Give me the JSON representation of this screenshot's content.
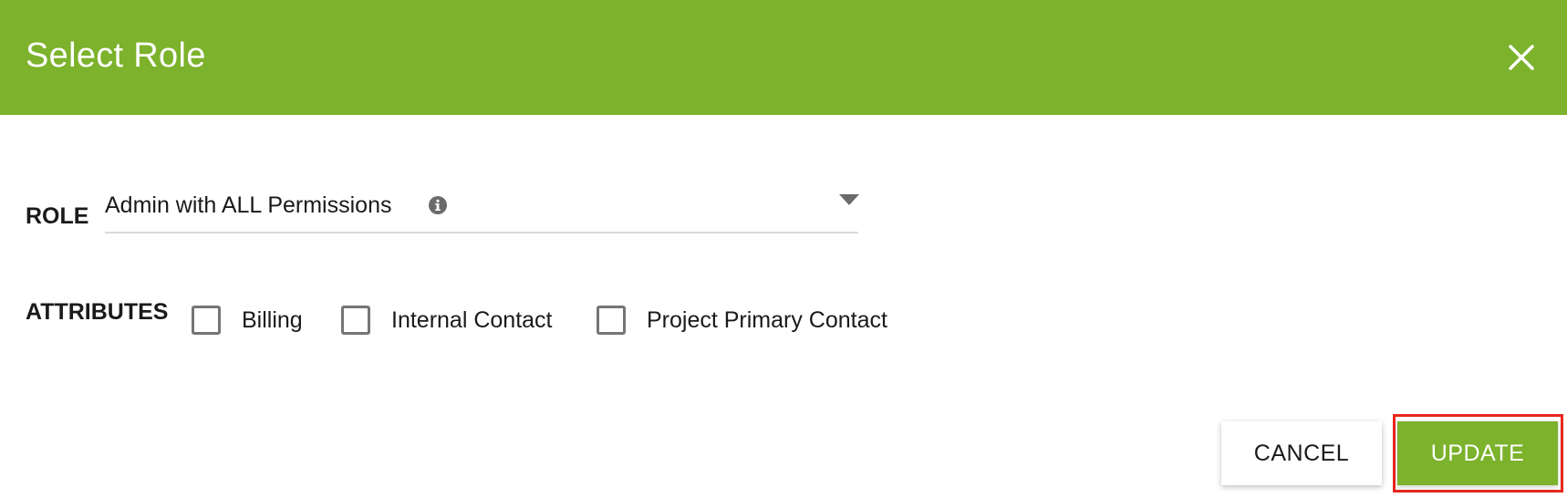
{
  "dialog": {
    "title": "Select Role",
    "close_icon": "close-icon",
    "header_color": "#7cb22c"
  },
  "role": {
    "label": "ROLE",
    "value": "Admin with ALL Permissions",
    "info_icon": "info-icon",
    "dropdown_icon": "caret-down-icon"
  },
  "attributes": {
    "label": "ATTRIBUTES",
    "options": [
      {
        "label": "Billing",
        "checked": false
      },
      {
        "label": "Internal Contact",
        "checked": false
      },
      {
        "label": "Project Primary Contact",
        "checked": false
      }
    ]
  },
  "actions": {
    "cancel_label": "CANCEL",
    "update_label": "UPDATE",
    "highlight_color": "#e8281e"
  }
}
